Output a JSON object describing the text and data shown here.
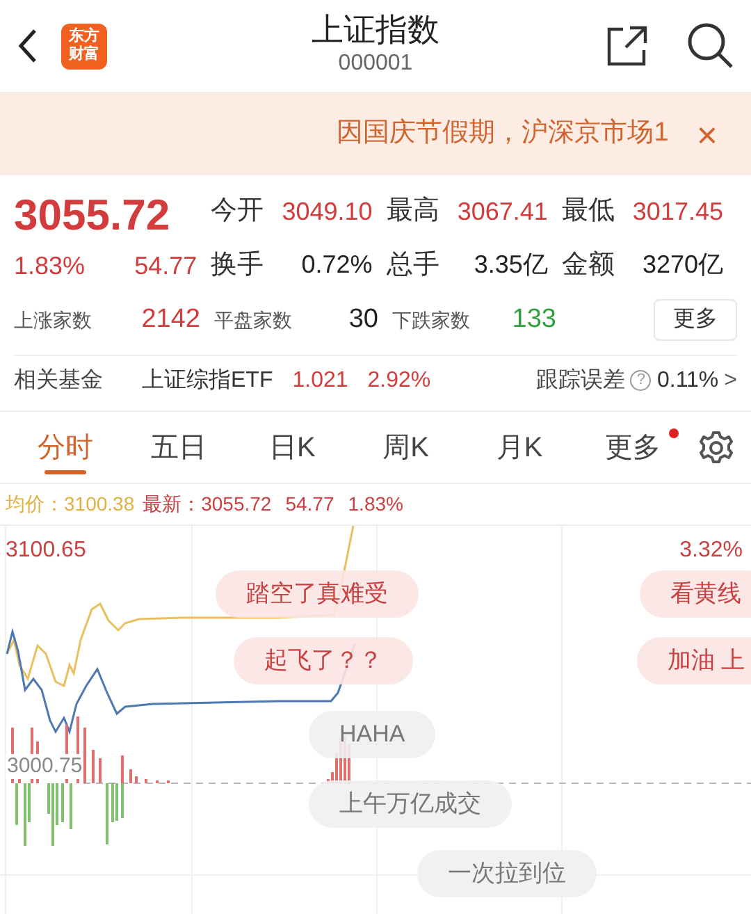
{
  "header": {
    "logo": [
      "东方",
      "财富"
    ],
    "title": "上证指数",
    "code": "000001"
  },
  "notice": {
    "text": "因国庆节假期，沪深京市场1",
    "close": "×"
  },
  "quote": {
    "price": "3055.72",
    "change_pct": "1.83%",
    "change": "54.77",
    "stats": [
      {
        "label": "今开",
        "value": "3049.10",
        "kind": "up"
      },
      {
        "label": "最高",
        "value": "3067.41",
        "kind": "up"
      },
      {
        "label": "最低",
        "value": "3017.45",
        "kind": "up"
      },
      {
        "label": "换手",
        "value": "0.72%",
        "kind": "plain"
      },
      {
        "label": "总手",
        "value": "3.35亿",
        "kind": "plain"
      },
      {
        "label": "金额",
        "value": "3270亿",
        "kind": "plain"
      }
    ],
    "breadth": [
      {
        "label": "上涨家数",
        "value": "2142",
        "kind": "up"
      },
      {
        "label": "平盘家数",
        "value": "30",
        "kind": "plain"
      },
      {
        "label": "下跌家数",
        "value": "133",
        "kind": "down"
      }
    ],
    "more": "更多"
  },
  "fund": {
    "label": "相关基金",
    "name": "上证综指ETF",
    "price": "1.021",
    "change": "2.92%",
    "error_label": "跟踪误差",
    "help": "?",
    "error": "0.11%",
    "arrow": ">"
  },
  "tabs": [
    {
      "label": "分时",
      "selected": true
    },
    {
      "label": "五日",
      "selected": false
    },
    {
      "label": "日K",
      "selected": false
    },
    {
      "label": "周K",
      "selected": false
    },
    {
      "label": "月K",
      "selected": false
    },
    {
      "label": "更多",
      "selected": false,
      "dot": true
    }
  ],
  "legend": {
    "avg_label": "均价：",
    "avg": "3100.38",
    "last_label": "最新：",
    "last": "3055.72",
    "change": "54.77",
    "change_pct": "1.83%"
  },
  "chart": {
    "top_price": "3100.65",
    "top_pct": "3.32%",
    "base_price": "3000.75"
  },
  "comments": [
    {
      "text": "踏空了真难受",
      "kind": "highlight"
    },
    {
      "text": "看黄线",
      "kind": "highlight"
    },
    {
      "text": "起飞了？？",
      "kind": "highlight"
    },
    {
      "text": "加油 上",
      "kind": "highlight"
    },
    {
      "text": "HAHA",
      "kind": "plain"
    },
    {
      "text": "上午万亿成交",
      "kind": "plain"
    },
    {
      "text": "一次拉到位",
      "kind": "plain"
    }
  ]
}
